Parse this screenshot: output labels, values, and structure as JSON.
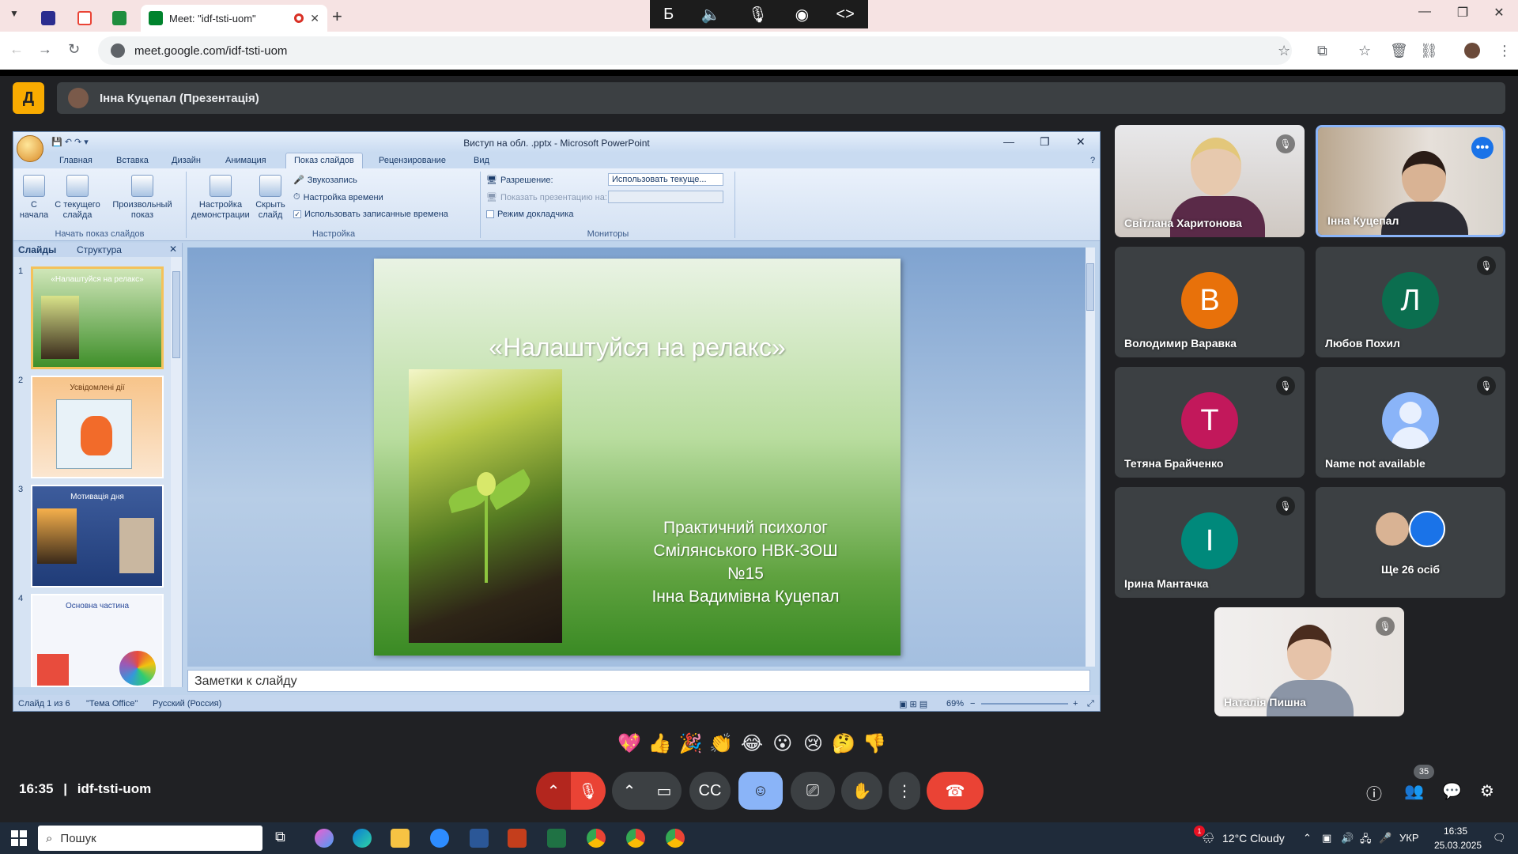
{
  "browser": {
    "active_tab_title": "Meet: \"idf-tsti-uom\"",
    "url": "meet.google.com/idf-tsti-uom",
    "close_tab": "✕",
    "new_tab": "+",
    "minimize": "—",
    "restore": "❐",
    "close": "✕"
  },
  "media_bar": {
    "icons": [
      "bold-b-icon",
      "speaker-icon",
      "mic-icon",
      "broadcast-icon",
      "code-icon"
    ],
    "glyphs": [
      "Б",
      "🔈",
      "🎙",
      "◉",
      "<>"
    ]
  },
  "presentation_header": {
    "logo_letter": "Д",
    "presenter_label": "Інна Куцепал (Презентація)"
  },
  "powerpoint": {
    "window_title": "Виступ на обл. .pptx - Microsoft PowerPoint",
    "ribbon_tabs": [
      "Главная",
      "Вставка",
      "Дизайн",
      "Анимация",
      "Показ слайдов",
      "Рецензирование",
      "Вид"
    ],
    "ribbon": {
      "from_start": "С начала",
      "from_current": "С текущего слайда",
      "custom_show": "Произвольный показ",
      "group_start": "Начать показ слайдов",
      "setup_show": "Настройка демонстрации",
      "hide_slide": "Скрыть слайд",
      "record_narration": "Звукозапись",
      "rehearse_timings": "Настройка времени",
      "use_timings": "Использовать записанные времена",
      "group_setup": "Настройка",
      "resolution_label": "Разрешение:",
      "resolution_value": "Использовать текуще...",
      "show_on_label": "Показать презентацию на:",
      "presenter_view": "Режим докладчика",
      "group_monitors": "Мониторы"
    },
    "pane_tabs": [
      "Слайды",
      "Структура"
    ],
    "thumbnails": [
      {
        "num": "1",
        "title": "«Налаштуйся на релакс»"
      },
      {
        "num": "2",
        "title": "Усвідомлені дії"
      },
      {
        "num": "3",
        "title": "Мотивація дня"
      },
      {
        "num": "4",
        "title": "Основна частина"
      }
    ],
    "slide": {
      "title": "«Налаштуйся на релакс»",
      "line1": "Практичний психолог",
      "line2": "Смілянського НВК-ЗОШ",
      "line3": "№15",
      "line4": "Інна  Вадимівна Куцепал"
    },
    "notes_placeholder": "Заметки к слайду",
    "status": {
      "slide_of": "Слайд 1 из 6",
      "theme": "\"Тема Office\"",
      "language": "Русский (Россия)",
      "zoom": "69%"
    }
  },
  "participants": [
    {
      "name": "Світлана Харитонова",
      "kind": "video",
      "muted": true
    },
    {
      "name": "Інна Куцепал",
      "kind": "video",
      "active": true
    },
    {
      "name": "Володимир Варавка",
      "kind": "letter",
      "letter": "В",
      "color": "#e8710a"
    },
    {
      "name": "Любов Похил",
      "kind": "letter",
      "letter": "Л",
      "color": "#0b6e4f",
      "muted": true
    },
    {
      "name": "Тетяна Брайченко",
      "kind": "letter",
      "letter": "Т",
      "color": "#c2185b",
      "muted": true
    },
    {
      "name": "Name not available",
      "kind": "generic",
      "muted": true
    },
    {
      "name": "Ірина Мантачка",
      "kind": "letter",
      "letter": "І",
      "color": "#00897b",
      "muted": true
    },
    {
      "name": "Ще 26 осіб",
      "kind": "group"
    },
    {
      "name": "Наталія Пишна",
      "kind": "video",
      "muted": true
    }
  ],
  "reactions": [
    "💖",
    "👍",
    "🎉",
    "👏",
    "😂",
    "😮",
    "😢",
    "🤔",
    "👎"
  ],
  "bottom_bar": {
    "time": "16:35",
    "separator": "|",
    "meeting_code": "idf-tsti-uom",
    "participants_count": "35"
  },
  "taskbar": {
    "search_placeholder": "Пошук",
    "weather": "12°C  Cloudy",
    "language": "УКР",
    "time": "16:35",
    "date": "25.03.2025",
    "weather_badge": "1"
  }
}
